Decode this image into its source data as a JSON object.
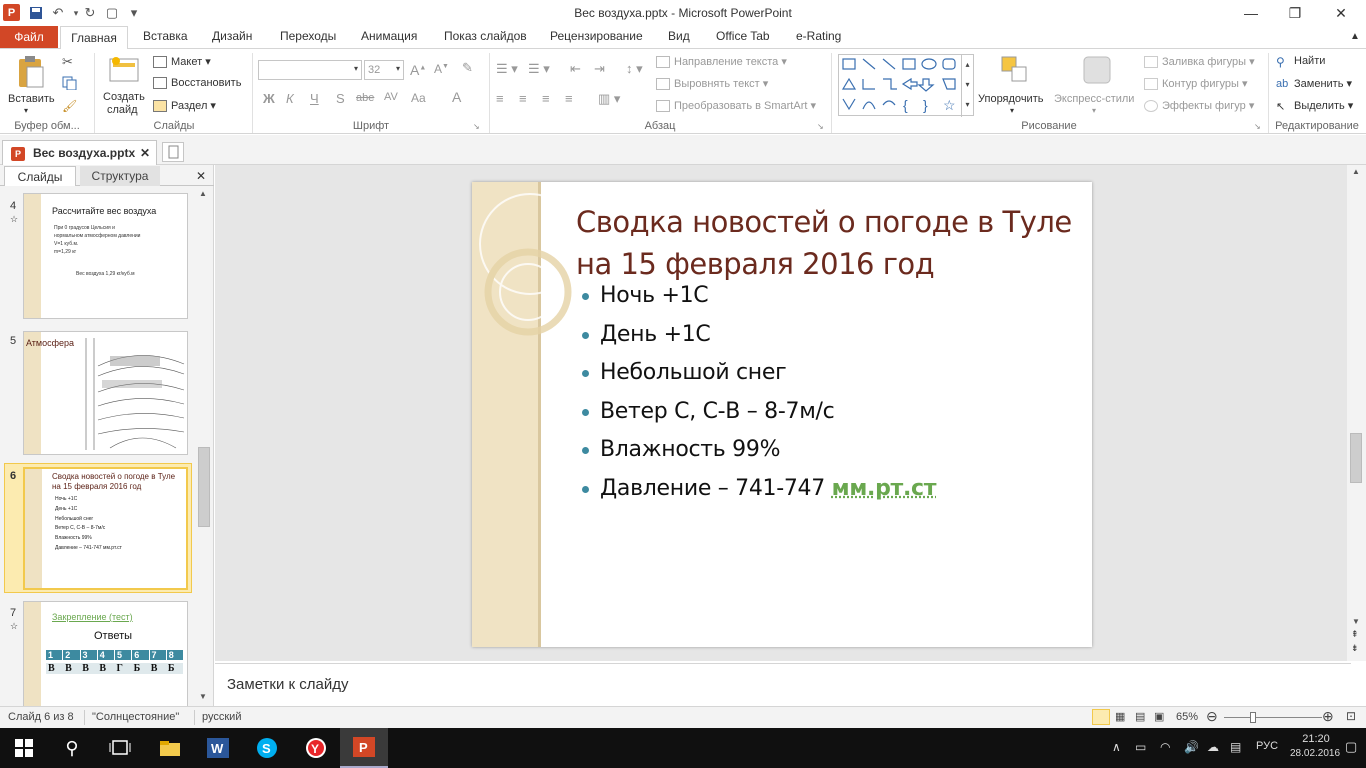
{
  "titlebar": {
    "title": "Вес воздуха.pptx - Microsoft PowerPoint",
    "app_icon_letter": "P",
    "quick_access": {
      "save": "💾",
      "undo": "↶",
      "redo": "↻",
      "new": "▢",
      "customize": "▾"
    },
    "window": {
      "minimize": "—",
      "maximize": "❐",
      "close": "✕"
    }
  },
  "tabs": [
    "Файл",
    "Главная",
    "Вставка",
    "Дизайн",
    "Переходы",
    "Анимация",
    "Показ слайдов",
    "Рецензирование",
    "Вид",
    "Office Tab",
    "e-Rating"
  ],
  "ribbon": {
    "clipboard": {
      "paste": "Вставить",
      "label": "Буфер обм..."
    },
    "slides": {
      "new_slide_line1": "Создать",
      "new_slide_line2": "слайд",
      "layout": "Макет",
      "reset": "Восстановить",
      "section": "Раздел",
      "label": "Слайды"
    },
    "font": {
      "font_size": "32",
      "bold": "Ж",
      "italic": "К",
      "underline": "Ч",
      "strike": "S",
      "abc": "abe",
      "spacing": "AV",
      "case": "Aa",
      "color": "A",
      "label": "Шрифт"
    },
    "paragraph": {
      "text_direction": "Направление текста",
      "align_text": "Выровнять текст",
      "smartart": "Преобразовать в SmartArt",
      "label": "Абзац"
    },
    "drawing": {
      "arrange": "Упорядочить",
      "quick_styles": "Экспресс-стили",
      "fill": "Заливка фигуры",
      "outline": "Контур фигуры",
      "effects": "Эффекты фигур",
      "label": "Рисование"
    },
    "editing": {
      "find": "Найти",
      "replace": "Заменить",
      "select": "Выделить",
      "label": "Редактирование"
    }
  },
  "doc_tab": {
    "name": "Вес воздуха.pptx",
    "close": "✕"
  },
  "pane_tabs": {
    "slides": "Слайды",
    "outline": "Структура",
    "close": "✕"
  },
  "thumbnails": [
    {
      "num": "4",
      "title": "Рассчитайте вес воздуха",
      "lines": [
        "При 0 градусов Цельсия и",
        "нормальном атмосферном давлении",
        "V=1 куб.м.",
        "m=1,29 кг"
      ],
      "footer": "Вес воздуха 1,29 кг/куб.м"
    },
    {
      "num": "5",
      "title": "Атмосфера"
    },
    {
      "num": "6",
      "title": "Сводка новостей о погоде в Туле на 15 февраля 2016 год",
      "lines": [
        "Ночь +1С",
        "День +1С",
        "Небольшой снег",
        "Ветер С, С-В – 8-7м/с",
        "Влажность 99%",
        "Давление – 741-747 мм.рт.ст"
      ]
    },
    {
      "num": "7",
      "title": "Закрепление (тест)",
      "subtitle": "Ответы",
      "header_row": [
        "1",
        "2",
        "3",
        "4",
        "5",
        "6",
        "7",
        "8"
      ],
      "answer_row": [
        "В",
        "В",
        "В",
        "В",
        "Г",
        "Б",
        "В",
        "Б"
      ]
    }
  ],
  "slide": {
    "title": "Сводка новостей о погоде в Туле на 15 февраля 2016 год",
    "bullets": [
      "Ночь +1С",
      "День +1С",
      "Небольшой снег",
      "Ветер С, С-В – 8-7м/с",
      "Влажность 99%",
      "Давление – 741-747 "
    ],
    "link_text": "мм.рт.ст"
  },
  "notes": {
    "placeholder": "Заметки к слайду"
  },
  "statusbar": {
    "slide_info": "Слайд 6 из 8",
    "theme": "\"Солнцестояние\"",
    "language": "русский",
    "zoom": "65%"
  },
  "taskbar": {
    "time": "21:20",
    "date": "28.02.2016",
    "lang": "РУС"
  }
}
